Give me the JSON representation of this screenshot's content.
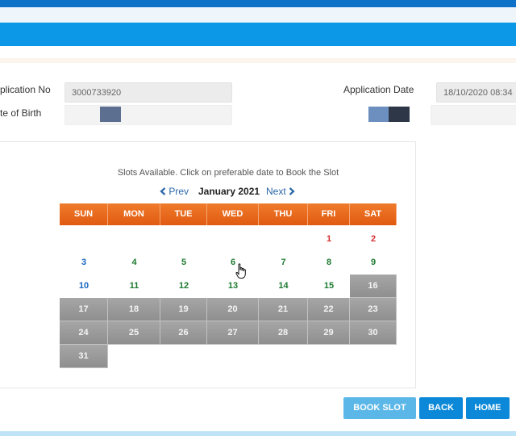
{
  "form": {
    "application_no_label": "plication No",
    "application_no_value": "3000733920",
    "application_date_label": "Application Date",
    "application_date_value": "18/10/2020 08:34",
    "dob_label": "te of Birth"
  },
  "calendar": {
    "message": "Slots Available. Click on preferable date to Book the Slot",
    "prev_label": "Prev",
    "next_label": "Next",
    "month_label": "January 2021",
    "weekdays": [
      "SUN",
      "MON",
      "TUE",
      "WED",
      "THU",
      "FRI",
      "SAT"
    ],
    "weeks": [
      [
        null,
        null,
        null,
        null,
        null,
        {
          "day": "1",
          "status": "holiday"
        },
        {
          "day": "2",
          "status": "holiday"
        }
      ],
      [
        {
          "day": "3",
          "status": "available"
        },
        {
          "day": "4",
          "status": "available"
        },
        {
          "day": "5",
          "status": "available"
        },
        {
          "day": "6",
          "status": "available"
        },
        {
          "day": "7",
          "status": "available"
        },
        {
          "day": "8",
          "status": "available"
        },
        {
          "day": "9",
          "status": "available"
        }
      ],
      [
        {
          "day": "10",
          "status": "available"
        },
        {
          "day": "11",
          "status": "available"
        },
        {
          "day": "12",
          "status": "available"
        },
        {
          "day": "13",
          "status": "available"
        },
        {
          "day": "14",
          "status": "available"
        },
        {
          "day": "15",
          "status": "available"
        },
        {
          "day": "16",
          "status": "unavailable"
        }
      ],
      [
        {
          "day": "17",
          "status": "unavailable"
        },
        {
          "day": "18",
          "status": "unavailable"
        },
        {
          "day": "19",
          "status": "unavailable"
        },
        {
          "day": "20",
          "status": "unavailable"
        },
        {
          "day": "21",
          "status": "unavailable"
        },
        {
          "day": "22",
          "status": "unavailable"
        },
        {
          "day": "23",
          "status": "unavailable"
        }
      ],
      [
        {
          "day": "24",
          "status": "unavailable"
        },
        {
          "day": "25",
          "status": "unavailable"
        },
        {
          "day": "26",
          "status": "unavailable"
        },
        {
          "day": "27",
          "status": "unavailable"
        },
        {
          "day": "28",
          "status": "unavailable"
        },
        {
          "day": "29",
          "status": "unavailable"
        },
        {
          "day": "30",
          "status": "unavailable"
        }
      ],
      [
        {
          "day": "31",
          "status": "unavailable"
        },
        null,
        null,
        null,
        null,
        null,
        null
      ]
    ]
  },
  "buttons": {
    "book_slot": "BOOK SLOT",
    "back": "BACK",
    "home": "HOME"
  },
  "colors": {
    "header_blue": "#0c98e6",
    "weekday_orange": "#e8621a",
    "available_text": "#1d7a30",
    "holiday_text": "#d32f2f",
    "unavailable_bg": "#9b9b9b"
  }
}
